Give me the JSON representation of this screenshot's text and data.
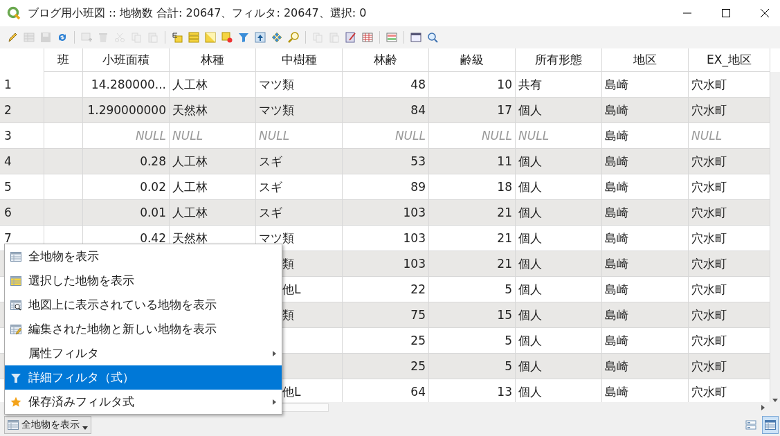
{
  "window": {
    "title": "ブログ用小班図 :: 地物数 合計: 20647、フィルタ: 20647、選択: 0"
  },
  "toolbar": [
    [
      {
        "kind": "pencil",
        "disabled": false
      },
      {
        "kind": "grid-edit",
        "disabled": true
      },
      {
        "kind": "save",
        "disabled": true
      },
      {
        "kind": "refresh",
        "disabled": false
      }
    ],
    [
      {
        "kind": "add-row",
        "disabled": true
      },
      {
        "kind": "delete",
        "disabled": true
      },
      {
        "kind": "cut",
        "disabled": true
      },
      {
        "kind": "copy",
        "disabled": true
      },
      {
        "kind": "paste",
        "disabled": true
      }
    ],
    [
      {
        "kind": "expression-select",
        "disabled": false
      },
      {
        "kind": "select-all",
        "disabled": false
      },
      {
        "kind": "invert",
        "disabled": false
      },
      {
        "kind": "deselect",
        "disabled": false
      },
      {
        "kind": "filter",
        "disabled": false
      },
      {
        "kind": "move-top",
        "disabled": false
      },
      {
        "kind": "pan",
        "disabled": false
      },
      {
        "kind": "zoom",
        "disabled": false
      }
    ],
    [
      {
        "kind": "copy",
        "disabled": true
      },
      {
        "kind": "paste",
        "disabled": true
      },
      {
        "kind": "field-calc",
        "disabled": false
      },
      {
        "kind": "table",
        "disabled": false
      }
    ],
    [
      {
        "kind": "conditional",
        "disabled": false
      }
    ],
    [
      {
        "kind": "dock",
        "disabled": false
      },
      {
        "kind": "actions",
        "disabled": false
      }
    ]
  ],
  "table": {
    "columns": [
      {
        "label": "班"
      },
      {
        "label": "小班面積",
        "numeric": true
      },
      {
        "label": "林種",
        "numeric": false
      },
      {
        "label": "中樹種",
        "numeric": false
      },
      {
        "label": "林齢",
        "numeric": true
      },
      {
        "label": "齢級",
        "numeric": true
      },
      {
        "label": "所有形態",
        "numeric": false
      },
      {
        "label": "地区",
        "numeric": false
      },
      {
        "label": "EX_地区",
        "numeric": false
      }
    ],
    "rows": [
      {
        "row_number": "1",
        "cells": [
          null,
          "14.280000...",
          "人工林",
          "マツ類",
          "48",
          "10",
          "共有",
          "島崎",
          "穴水町"
        ]
      },
      {
        "row_number": "2",
        "cells": [
          null,
          "1.290000000",
          "天然林",
          "マツ類",
          "84",
          "17",
          "個人",
          "島崎",
          "穴水町"
        ]
      },
      {
        "row_number": "3",
        "cells": [
          null,
          {
            "text": "NULL",
            "is_null": true
          },
          {
            "text": "NULL",
            "is_null": true
          },
          {
            "text": "NULL",
            "is_null": true
          },
          {
            "text": "NULL",
            "is_null": true
          },
          {
            "text": "NULL",
            "is_null": true
          },
          {
            "text": "NULL",
            "is_null": true
          },
          "島崎",
          {
            "text": "NULL",
            "is_null": true
          }
        ]
      },
      {
        "row_number": "4",
        "cells": [
          null,
          "0.28",
          "人工林",
          "スギ",
          "53",
          "11",
          "個人",
          "島崎",
          "穴水町"
        ]
      },
      {
        "row_number": "5",
        "cells": [
          null,
          "0.02",
          "人工林",
          "スギ",
          "89",
          "18",
          "個人",
          "島崎",
          "穴水町"
        ]
      },
      {
        "row_number": "6",
        "cells": [
          null,
          "0.01",
          "人工林",
          "スギ",
          "103",
          "21",
          "個人",
          "島崎",
          "穴水町"
        ]
      },
      {
        "row_number": "7",
        "cells": [
          null,
          "0.42",
          "天然林",
          "マツ類",
          "103",
          "21",
          "個人",
          "島崎",
          "穴水町"
        ]
      },
      {
        "cells": [
          null,
          null,
          null,
          "類",
          "103",
          "21",
          "個人",
          "島崎",
          "穴水町"
        ]
      },
      {
        "cells": [
          null,
          null,
          null,
          "他L",
          "22",
          "5",
          "個人",
          "島崎",
          "穴水町"
        ]
      },
      {
        "cells": [
          null,
          null,
          null,
          "類",
          "75",
          "15",
          "個人",
          "島崎",
          "穴水町"
        ]
      },
      {
        "cells": [
          null,
          null,
          null,
          null,
          "25",
          "5",
          "個人",
          "島崎",
          "穴水町"
        ]
      },
      {
        "cells": [
          null,
          null,
          null,
          null,
          "25",
          "5",
          "個人",
          "島崎",
          "穴水町"
        ]
      },
      {
        "cells": [
          null,
          null,
          null,
          "他L",
          "64",
          "13",
          "個人",
          "島崎",
          "穴水町"
        ]
      }
    ]
  },
  "context_menu": [
    {
      "label": "全地物を表示",
      "kind": "table",
      "submenu": false,
      "selected": false
    },
    {
      "label": "選択した地物を表示",
      "kind": "table-selected",
      "submenu": false,
      "selected": false
    },
    {
      "label": "地図上に表示されている地物を表示",
      "kind": "table-magnifier",
      "submenu": false,
      "selected": false
    },
    {
      "label": "編集された地物と新しい地物を表示",
      "kind": "table-pencil",
      "submenu": false,
      "selected": false
    },
    {
      "label": "属性フィルタ",
      "kind": "plain",
      "submenu": true,
      "selected": false
    },
    {
      "label": "詳細フィルタ（式）",
      "kind": "funnel",
      "submenu": false,
      "selected": true
    },
    {
      "label": "保存済みフィルタ式",
      "kind": "star",
      "submenu": true,
      "selected": false
    }
  ],
  "status_bar": {
    "filter_button": "全地物を表示",
    "views": [
      {
        "kind": "form",
        "selected": false
      },
      {
        "kind": "table",
        "selected": true
      }
    ]
  }
}
